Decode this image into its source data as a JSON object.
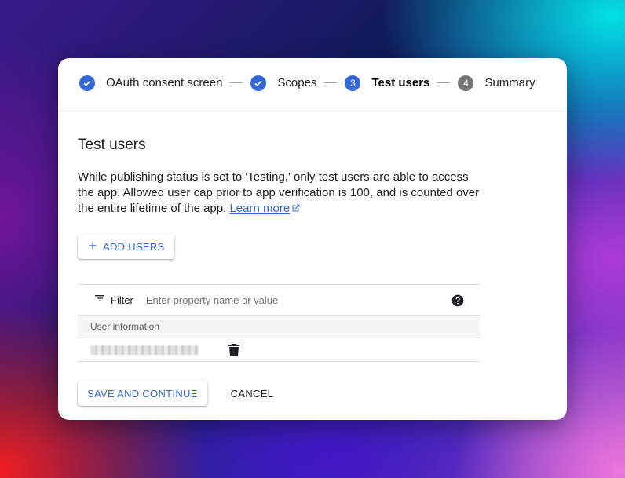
{
  "stepper": {
    "steps": [
      {
        "label": "OAuth consent screen",
        "state": "done",
        "icon": "check-icon"
      },
      {
        "label": "Scopes",
        "state": "done",
        "icon": "check-icon"
      },
      {
        "label": "Test users",
        "state": "active",
        "number": "3"
      },
      {
        "label": "Summary",
        "state": "pending",
        "number": "4"
      }
    ]
  },
  "main": {
    "title": "Test users",
    "description": "While publishing status is set to 'Testing,' only test users are able to access the app. Allowed user cap prior to app verification is 100, and is counted over the entire lifetime of the app.",
    "learn_more": "Learn more",
    "add_users_label": "ADD USERS"
  },
  "table": {
    "filter_label": "Filter",
    "filter_placeholder": "Enter property name or value",
    "columns": [
      "User information"
    ],
    "rows": [
      {
        "user": "",
        "redacted": true
      }
    ]
  },
  "footer": {
    "save_label": "SAVE AND CONTINUE",
    "cancel_label": "CANCEL"
  },
  "colors": {
    "accent": "#3367d6",
    "pending_step": "#757575"
  }
}
